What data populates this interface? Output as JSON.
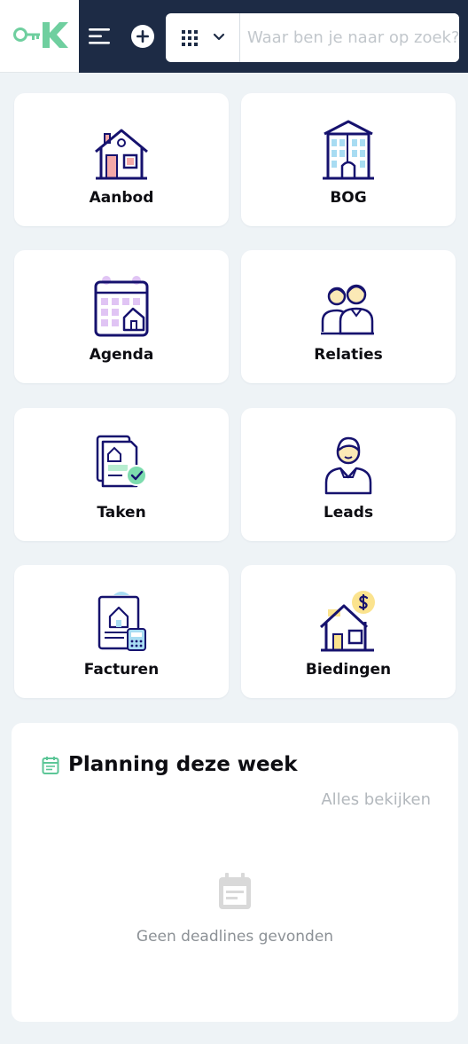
{
  "header": {
    "logo_alt": "K",
    "search_placeholder": "Waar ben je naar op zoek?"
  },
  "tiles": [
    {
      "label": "Aanbod"
    },
    {
      "label": "BOG"
    },
    {
      "label": "Agenda"
    },
    {
      "label": "Relaties"
    },
    {
      "label": "Taken"
    },
    {
      "label": "Leads"
    },
    {
      "label": "Facturen"
    },
    {
      "label": "Biedingen"
    }
  ],
  "planning": {
    "title": "Planning deze week",
    "view_all": "Alles bekijken",
    "empty_text": "Geen deadlines gevonden"
  },
  "colors": {
    "header_bg": "#1d2b45",
    "brand_green": "#6fcf9f",
    "icon_navy": "#16126e",
    "page_bg": "#eef3f6"
  }
}
